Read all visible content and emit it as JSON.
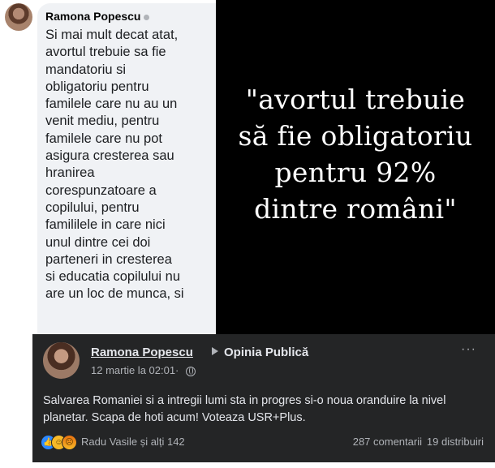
{
  "comment": {
    "author": "Ramona Popescu",
    "text": "Si mai mult decat atat,\navortul trebuie sa fie\nmandatoriu si\nobligatoriu pentru\nfamilele care nu au un\nvenit mediu, pentru\nfamilele care nu pot\nasigura cresterea sau\nhranirea\ncorespunzatoare a\ncopilului, pentru\nfamililele in care nici\nunul dintre cei doi\nparteneri in cresterea\nsi educatia copilului nu\nare un loc de munca, si"
  },
  "quote": {
    "text": "\"avortul trebuie\nsă fie obligatoriu\npentru 92%\ndintre români\""
  },
  "post": {
    "author": "Ramona Popescu",
    "page": "Opinia Publică",
    "more": "···",
    "date": "12 martie la 02:01",
    "separator": "·",
    "body": "Salvarea Romaniei si a intregii lumi sta in progres si-o noua oranduire la nivel planetar. Scapa de hoti acum! Voteaza USR+Plus.",
    "reactions": [
      "like-icon",
      "haha-icon",
      "angry-icon"
    ],
    "reaction_names": "Radu Vasile și alți 142",
    "comments": "287 comentarii",
    "shares": "19 distribuiri"
  },
  "colors": {
    "post_bg": "#242526",
    "quote_bg": "#000000",
    "bubble_bg": "#f0f2f5",
    "like_blue": "#2d88ff"
  }
}
